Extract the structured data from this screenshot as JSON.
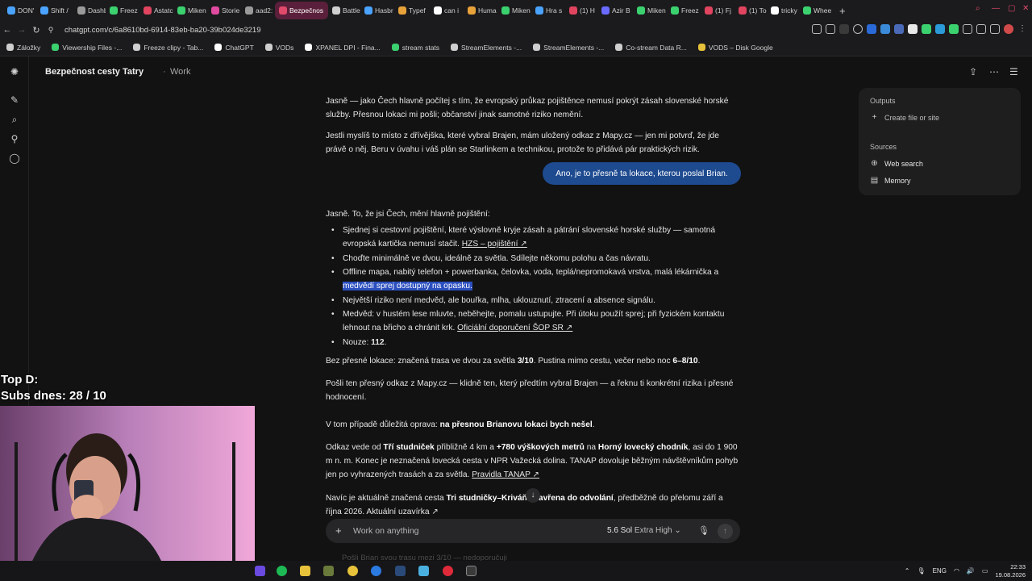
{
  "browser": {
    "tabs": [
      {
        "label": "DON'",
        "color": "#4aa3ff"
      },
      {
        "label": "Shift /",
        "color": "#4aa3ff"
      },
      {
        "label": "Dashb",
        "color": "#9a9a9a"
      },
      {
        "label": "Freez",
        "color": "#3bd16f"
      },
      {
        "label": "Astatc",
        "color": "#e0445e"
      },
      {
        "label": "Miken",
        "color": "#3bd16f"
      },
      {
        "label": "Storie",
        "color": "#e04aa0"
      },
      {
        "label": "aad2:",
        "color": "#9a9a9a"
      },
      {
        "label": "Bezpečnos",
        "color": "#e04a6a"
      },
      {
        "label": "Battle",
        "color": "#cfcfcf"
      },
      {
        "label": "Hasbr",
        "color": "#4aa3ff"
      },
      {
        "label": "Typef",
        "color": "#e8a23a"
      },
      {
        "label": "can i",
        "color": "#ffffff"
      },
      {
        "label": "Huma",
        "color": "#e8a23a"
      },
      {
        "label": "Miken",
        "color": "#3bd16f"
      },
      {
        "label": "Hra s",
        "color": "#4aa3ff"
      },
      {
        "label": "(1) H",
        "color": "#e0445e"
      },
      {
        "label": "Azir B",
        "color": "#6a6aff"
      },
      {
        "label": "Miken",
        "color": "#3bd16f"
      },
      {
        "label": "Freez",
        "color": "#3bd16f"
      },
      {
        "label": "(1) Fj",
        "color": "#e0445e"
      },
      {
        "label": "(1) To",
        "color": "#e0445e"
      },
      {
        "label": "tricky",
        "color": "#ffffff"
      },
      {
        "label": "Whee",
        "color": "#3bd16f"
      }
    ],
    "active_tab_index": 8,
    "url": "chatgpt.com/c/6a8610bd-6914-83eb-ba20-39b024de3219",
    "bookmarks": [
      {
        "label": "Záložky",
        "color": "#cfcfcf"
      },
      {
        "label": "Viewership Files -...",
        "color": "#3bd16f"
      },
      {
        "label": "Freeze clipy - Tab...",
        "color": "#cfcfcf"
      },
      {
        "label": "ChatGPT",
        "color": "#ffffff"
      },
      {
        "label": "VODs",
        "color": "#cfcfcf"
      },
      {
        "label": "XPANEL DPI - Fina...",
        "color": "#ffffff"
      },
      {
        "label": "stream stats",
        "color": "#3bd16f"
      },
      {
        "label": "StreamElements -...",
        "color": "#cfcfcf"
      },
      {
        "label": "StreamElements -...",
        "color": "#cfcfcf"
      },
      {
        "label": "Co-stream Data R...",
        "color": "#cfcfcf"
      },
      {
        "label": "VODS – Disk Google",
        "color": "#e8c23a"
      }
    ]
  },
  "header": {
    "title": "Bezpečnost cesty Tatry",
    "dot": "·",
    "project": "Work"
  },
  "chat": {
    "p1": "Jasně — jako Čech hlavně počítej s tím, že evropský průkaz pojištěnce nemusí pokrýt zásah slovenské horské služby. Přesnou lokaci mi pošli; občanství jinak samotné riziko nemění.",
    "p2": "Jestli myslíš to místo z dřívějška, které vybral Brajen, mám uložený odkaz z Mapy.cz — jen mi potvrď, že jde právě o něj. Beru v úvahu i váš plán se Starlinkem a technikou, protože to přidává pár praktických rizik.",
    "user_message": "Ano, je to přesně ta lokace, kterou poslal Brian.",
    "p3": "Jasně. To, že jsi Čech, mění hlavně pojištění:",
    "bullets": {
      "b1_text": "Sjednej si cestovní pojištění, které výslovně kryje zásah a pátrání slovenské horské služby — samotná evropská kartička nemusí stačit.",
      "b1_link": "HZS – pojištění ↗",
      "b2": "Choďte minimálně ve dvou, ideálně za světla. Sdílejte někomu polohu a čas návratu.",
      "b3_text": "Offline mapa, nabitý telefon + powerbanka, čelovka, voda, teplá/nepromokavá vrstva, malá lékárnička a",
      "b3_highlight": "medvědí sprej dostupný na opasku.",
      "b4": "Největší riziko není medvěd, ale bouřka, mlha, uklouznutí, ztracení a absence signálu.",
      "b5_text": "Medvěd: v hustém lese mluvte, neběhejte, pomalu ustupujte. Při útoku použít sprej; při fyzickém kontaktu lehnout na břicho a chránit krk.",
      "b5_link": "Oficiální doporučení ŠOP SR ↗",
      "b6_pre": "Nouze:",
      "b6_bold": "112",
      "b6_post": "."
    },
    "p4_pre": "Bez přesné lokace: značená trasa ve dvou za světla",
    "p4_v1": "3/10",
    "p4_mid": ". Pustina mimo cestu, večer nebo noc",
    "p4_v2": "6–8/10",
    "p4_post": ".",
    "p5": "Pošli ten přesný odkaz z Mapy.cz — klidně ten, který předtím vybral Brajen — a řeknu ti konkrétní rizika i přesné hodnocení.",
    "p6_pre": "V tom případě důležitá oprava:",
    "p6_bold": "na přesnou Brianovu lokaci bych nešel",
    "p6_post": ".",
    "p7_a": "Odkaz vede od",
    "p7_b": "Tří studniček",
    "p7_c": "přibližně 4 km a",
    "p7_d": "+780 výškových metrů",
    "p7_e": "na",
    "p7_f": "Horný lovecký chodník",
    "p7_g": ", asi do 1 900 m n. m. Konec je neznačená lovecká cesta v NPR Važecká dolina. TANAP dovoluje běžným návštěvníkům pohyb jen po vyhrazených trasách a za světla.",
    "p7_link": "Pravidla TANAP ↗",
    "p8_a": "Navíc je aktuálně značená cesta",
    "p8_b": "Tri studničky–Kriváň",
    "p8_c": "uzavřena do odvolání",
    "p8_d": ", předběžně do přelomu září a října 2026. Aktuální uzavírka ↗",
    "faded": "Pošli Brian svou trasu mezi 3/10 — nedoporučuji"
  },
  "right_panel": {
    "outputs_label": "Outputs",
    "create_label": "Create file or site",
    "sources_label": "Sources",
    "web_search_label": "Web search",
    "memory_label": "Memory"
  },
  "composer": {
    "placeholder": "Work on anything",
    "model": "5.6 Sol",
    "effort": "Extra High"
  },
  "overlay": {
    "line1": "Top D:",
    "line2": "Subs dnes: 28 / 10"
  },
  "taskbar": {
    "lang": "ENG",
    "time": "22:33",
    "date": "19.08.2026"
  }
}
